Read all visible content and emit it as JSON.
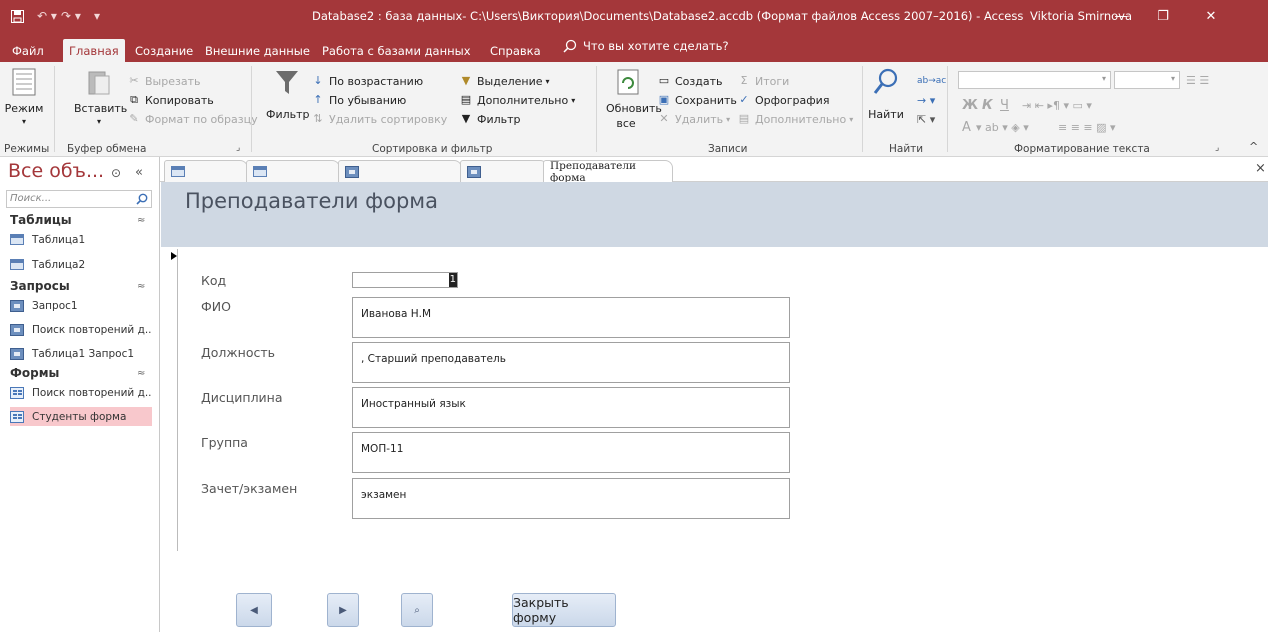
{
  "titlebar": {
    "title": "Database2 : база данных- C:\\Users\\Виктория\\Documents\\Database2.accdb (Формат файлов Access 2007–2016)  -  Access",
    "user": "Viktoria Smirnova",
    "accent": "#a4373a"
  },
  "ribbon_tabs": [
    {
      "label": "Файл"
    },
    {
      "label": "Главная"
    },
    {
      "label": "Создание"
    },
    {
      "label": "Внешние данные"
    },
    {
      "label": "Работа с базами данных"
    },
    {
      "label": "Справка"
    }
  ],
  "tell_me": "Что вы хотите сделать?",
  "ribbon": {
    "views": {
      "mode": "Режим",
      "group": "Режимы"
    },
    "clipboard": {
      "paste": "Вставить",
      "cut": "Вырезать",
      "copy": "Копировать",
      "format_painter": "Формат по образцу",
      "group": "Буфер обмена"
    },
    "sort_filter": {
      "filter": "Фильтр",
      "ascending": "По возрастанию",
      "descending": "По убыванию",
      "remove_sort": "Удалить сортировку",
      "selection": "Выделение",
      "advanced": "Дополнительно",
      "toggle_filter": "Фильтр",
      "group": "Сортировка и фильтр"
    },
    "records": {
      "refresh_line1": "Обновить",
      "refresh_line2": "все",
      "new": "Создать",
      "save": "Сохранить",
      "delete": "Удалить",
      "totals": "Итоги",
      "spelling": "Орфография",
      "more": "Дополнительно",
      "group": "Записи"
    },
    "find": {
      "find": "Найти",
      "group": "Найти"
    },
    "text_format": {
      "bold": "Ж",
      "italic": "К",
      "underline": "Ч",
      "font_color": "А",
      "group": "Форматирование текста"
    }
  },
  "nav": {
    "title": "Все объ...",
    "search_placeholder": "Поиск...",
    "groups": {
      "tables": {
        "label": "Таблицы",
        "items": [
          "Таблица1",
          "Таблица2"
        ]
      },
      "queries": {
        "label": "Запросы",
        "items": [
          "Запрос1",
          "Поиск повторений д...",
          "Таблица1 Запрос1"
        ]
      },
      "forms": {
        "label": "Формы",
        "items": [
          "Поиск повторений д...",
          "Студенты форма"
        ]
      }
    }
  },
  "doc_tabs": {
    "active": "Преподаватели форма"
  },
  "form": {
    "title": "Преподаватели форма",
    "fields": {
      "kod": {
        "label": "Код",
        "value": "1"
      },
      "fio": {
        "label": "ФИО",
        "value": "Иванова Н.М"
      },
      "position": {
        "label": "Должность",
        "value": ", Старший преподаватель"
      },
      "discipline": {
        "label": "Дисциплина",
        "value": "Иностранный язык"
      },
      "group": {
        "label": "Группа",
        "value": "МОП-11"
      },
      "exam": {
        "label": "Зачет/экзамен",
        "value": "экзамен"
      }
    },
    "buttons": {
      "close": "Закрыть форму"
    }
  }
}
